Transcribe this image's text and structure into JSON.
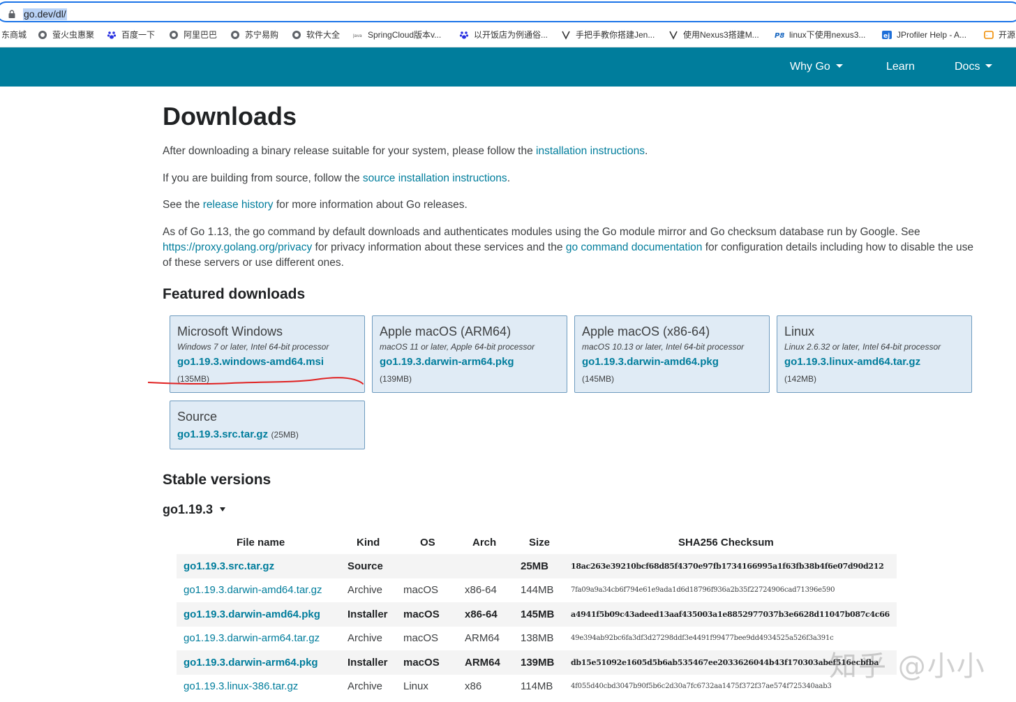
{
  "browser": {
    "url": "go.dev/dl/",
    "bookmarks": [
      {
        "label": "东商城",
        "icon": "page-icon"
      },
      {
        "label": "萤火虫惠聚",
        "icon": "globe-icon"
      },
      {
        "label": "百度一下",
        "icon": "baidu-paw-icon"
      },
      {
        "label": "阿里巴巴",
        "icon": "globe-icon"
      },
      {
        "label": "苏宁易购",
        "icon": "globe-icon"
      },
      {
        "label": "软件大全",
        "icon": "globe-icon"
      },
      {
        "label": "SpringCloud版本v...",
        "icon": "java-icon"
      },
      {
        "label": "以开饭店为例通俗...",
        "icon": "baidu-paw-icon"
      },
      {
        "label": "手把手教你搭建Jen...",
        "icon": "bookmark-logo-icon"
      },
      {
        "label": "使用Nexus3搭建M...",
        "icon": "bookmark-logo-icon"
      },
      {
        "label": "linux下使用nexus3...",
        "icon": "p8-icon"
      },
      {
        "label": "JProfiler Help - A...",
        "icon": "ej-icon"
      },
      {
        "label": "开源",
        "icon": "code-bracket-icon"
      }
    ]
  },
  "nav": {
    "why_go": "Why Go",
    "learn": "Learn",
    "docs": "Docs"
  },
  "page": {
    "title": "Downloads",
    "p1_pre": "After downloading a binary release suitable for your system, please follow the ",
    "p1_link": "installation instructions",
    "p1_post": ".",
    "p2_pre": "If you are building from source, follow the ",
    "p2_link": "source installation instructions",
    "p2_post": ".",
    "p3_pre": "See the ",
    "p3_link": "release history",
    "p3_post": " for more information about Go releases.",
    "p4_a": "As of Go 1.13, the go command by default downloads and authenticates modules using the Go module mirror and Go checksum database run by Google. See ",
    "p4_link1": "https://proxy.golang.org/privacy",
    "p4_b": " for privacy information about these services and the ",
    "p4_link2": "go command documentation",
    "p4_c": " for configuration details including how to disable the use of these servers or use different ones.",
    "featured_heading": "Featured downloads",
    "stable_heading": "Stable versions",
    "version": "go1.19.3"
  },
  "featured": [
    {
      "os": "Microsoft Windows",
      "desc": "Windows 7 or later, Intel 64-bit processor",
      "file": "go1.19.3.windows-amd64.msi",
      "size": "(135MB)"
    },
    {
      "os": "Apple macOS (ARM64)",
      "desc": "macOS 11 or later, Apple 64-bit processor",
      "file": "go1.19.3.darwin-arm64.pkg",
      "size": "(139MB)"
    },
    {
      "os": "Apple macOS (x86-64)",
      "desc": "macOS 10.13 or later, Intel 64-bit processor",
      "file": "go1.19.3.darwin-amd64.pkg",
      "size": "(145MB)"
    },
    {
      "os": "Linux",
      "desc": "Linux 2.6.32 or later, Intel 64-bit processor",
      "file": "go1.19.3.linux-amd64.tar.gz",
      "size": "(142MB)"
    }
  ],
  "source_card": {
    "os": "Source",
    "file": "go1.19.3.src.tar.gz",
    "size": "(25MB)"
  },
  "table": {
    "headers": [
      "File name",
      "Kind",
      "OS",
      "Arch",
      "Size",
      "SHA256 Checksum"
    ],
    "rows": [
      {
        "file": "go1.19.3.src.tar.gz",
        "kind": "Source",
        "os": "",
        "arch": "",
        "size": "25MB",
        "checksum": "18ac263e39210bcf68d85f4370e97fb1734166995a1f63fb38b4f6e07d90d212",
        "highlight": true
      },
      {
        "file": "go1.19.3.darwin-amd64.tar.gz",
        "kind": "Archive",
        "os": "macOS",
        "arch": "x86-64",
        "size": "144MB",
        "checksum": "7fa09a9a34cb6f794e61e9ada1d6d18796f936a2b35f22724906cad71396e590",
        "highlight": false
      },
      {
        "file": "go1.19.3.darwin-amd64.pkg",
        "kind": "Installer",
        "os": "macOS",
        "arch": "x86-64",
        "size": "145MB",
        "checksum": "a4941f5b09c43adeed13aaf435003a1e8852977037b3e6628d11047b087c4c66",
        "highlight": true
      },
      {
        "file": "go1.19.3.darwin-arm64.tar.gz",
        "kind": "Archive",
        "os": "macOS",
        "arch": "ARM64",
        "size": "138MB",
        "checksum": "49e394ab92bc6fa3df3d27298ddf3e4491f99477bee9dd4934525a526f3a391c",
        "highlight": false
      },
      {
        "file": "go1.19.3.darwin-arm64.pkg",
        "kind": "Installer",
        "os": "macOS",
        "arch": "ARM64",
        "size": "139MB",
        "checksum": "db15e51092e1605d5b6ab535467ee2033626044b43f170303abef516ecbfba",
        "highlight": true
      },
      {
        "file": "go1.19.3.linux-386.tar.gz",
        "kind": "Archive",
        "os": "Linux",
        "arch": "x86",
        "size": "114MB",
        "checksum": "4f055d40cbd3047b90f5b6c2d30a7fc6732aa1475f372f37ae574f725340aab3",
        "highlight": false
      }
    ]
  },
  "watermark": "知乎 @小小",
  "colors": {
    "brand": "#007d9c",
    "card_bg": "#e0ebf5",
    "annotation": "#e02020"
  }
}
